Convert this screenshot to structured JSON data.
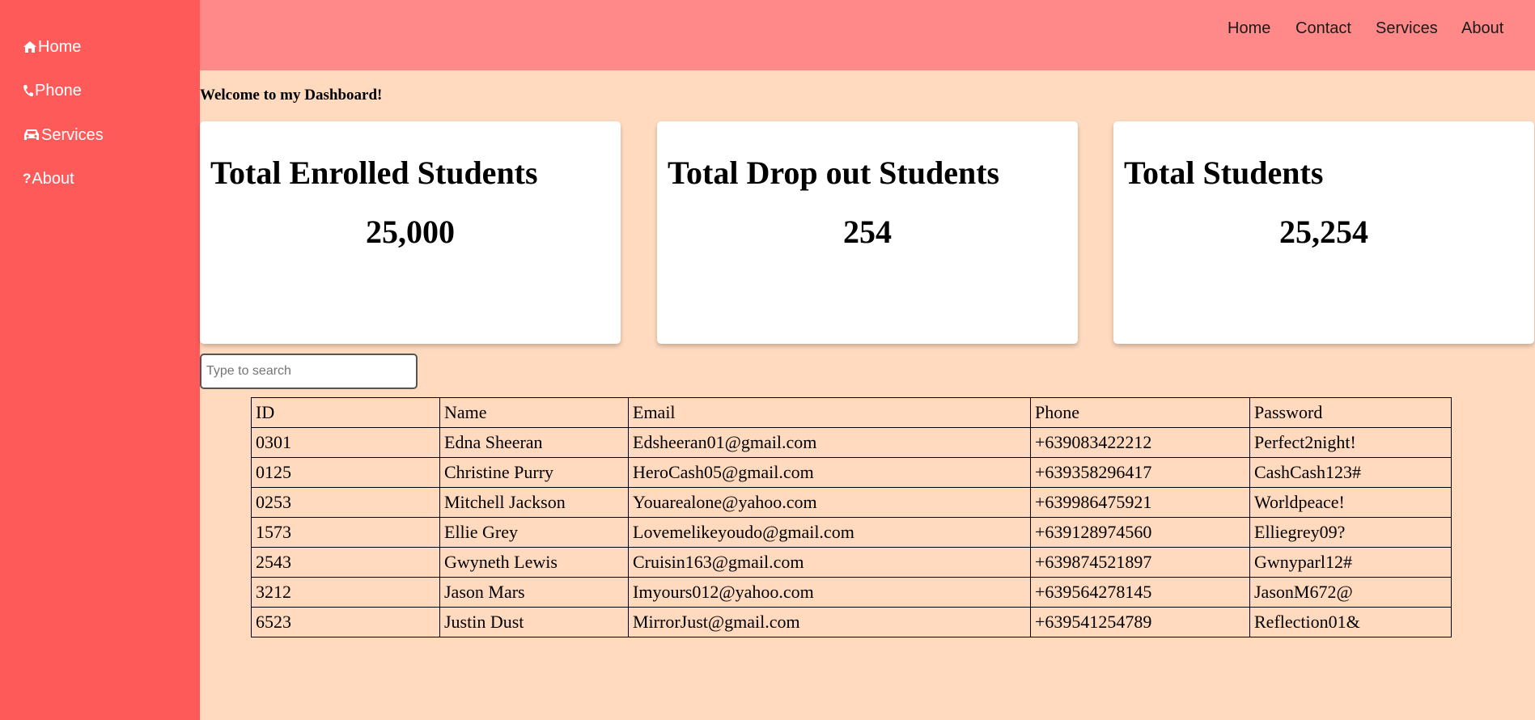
{
  "sidebar": {
    "items": [
      {
        "label": "Home",
        "icon": "home-icon"
      },
      {
        "label": "Phone",
        "icon": "phone-icon"
      },
      {
        "label": "Services",
        "icon": "car-icon"
      },
      {
        "label": "About",
        "icon": "question-icon"
      }
    ]
  },
  "topnav": {
    "links": [
      "Home",
      "Contact",
      "Services",
      "About"
    ]
  },
  "welcome": "Welcome to my Dashboard!",
  "cards": [
    {
      "title": "Total Enrolled Students",
      "value": "25,000"
    },
    {
      "title": "Total Drop out Students",
      "value": "254"
    },
    {
      "title": "Total Students",
      "value": "25,254"
    }
  ],
  "search": {
    "placeholder": "Type to search",
    "value": ""
  },
  "table": {
    "headers": [
      "ID",
      "Name",
      "Email",
      "Phone",
      "Password"
    ],
    "rows": [
      [
        "0301",
        "Edna Sheeran",
        "Edsheeran01@gmail.com",
        "+639083422212",
        "Perfect2night!"
      ],
      [
        "0125",
        "Christine Purry",
        "HeroCash05@gmail.com",
        "+639358296417",
        "CashCash123#"
      ],
      [
        "0253",
        "Mitchell Jackson",
        "Youarealone@yahoo.com",
        "+639986475921",
        "Worldpeace!"
      ],
      [
        "1573",
        "Ellie Grey",
        "Lovemelikeyoudo@gmail.com",
        "+639128974560",
        "Elliegrey09?"
      ],
      [
        "2543",
        "Gwyneth Lewis",
        "Cruisin163@gmail.com",
        "+639874521897",
        "Gwnyparl12#"
      ],
      [
        "3212",
        "Jason Mars",
        "Imyours012@yahoo.com",
        "+639564278145",
        "JasonM672@"
      ],
      [
        "6523",
        "Justin Dust",
        "MirrorJust@gmail.com",
        "+639541254789",
        "Reflection01&"
      ]
    ]
  },
  "colors": {
    "background": "#ffdabf",
    "sidebar": "#ff5a5a",
    "topbar": "#ff8888",
    "card": "#ffffff"
  }
}
